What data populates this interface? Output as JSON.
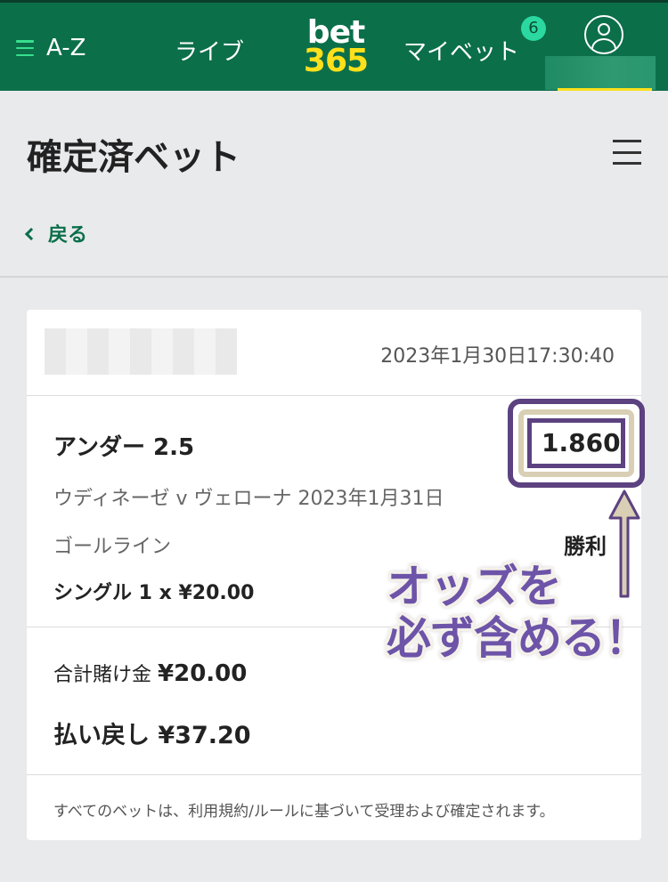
{
  "nav": {
    "az_label": "A-Z",
    "live_label": "ライブ",
    "logo_line1": "bet",
    "logo_line2": "365",
    "mybets_label": "マイベット",
    "mybets_badge": "6"
  },
  "header": {
    "title": "確定済ベット",
    "back_label": "戻る"
  },
  "bet": {
    "datetime": "2023年1月30日17:30:40",
    "selection": "アンダー 2.5",
    "odds": "1.860",
    "event": "ウディネーゼ v ヴェローナ 2023年1月31日",
    "market": "ゴールライン",
    "result": "勝利",
    "bet_type": "シングル 1 x ¥20.00",
    "stake_label": "合計賭け金",
    "stake_value": "¥20.00",
    "payout": "払い戻し ¥37.20",
    "terms": "すべてのベットは、利用規約/ルールに基づいて受理および確定されます。"
  },
  "annotation": {
    "callout_line1": "オッズを",
    "callout_line2": "必ず含める！"
  },
  "colors": {
    "brand_green": "#0b6f4a",
    "brand_yellow": "#ffe01b",
    "badge_green": "#2bd9a0",
    "annotation_purple": "#6d54a8"
  }
}
